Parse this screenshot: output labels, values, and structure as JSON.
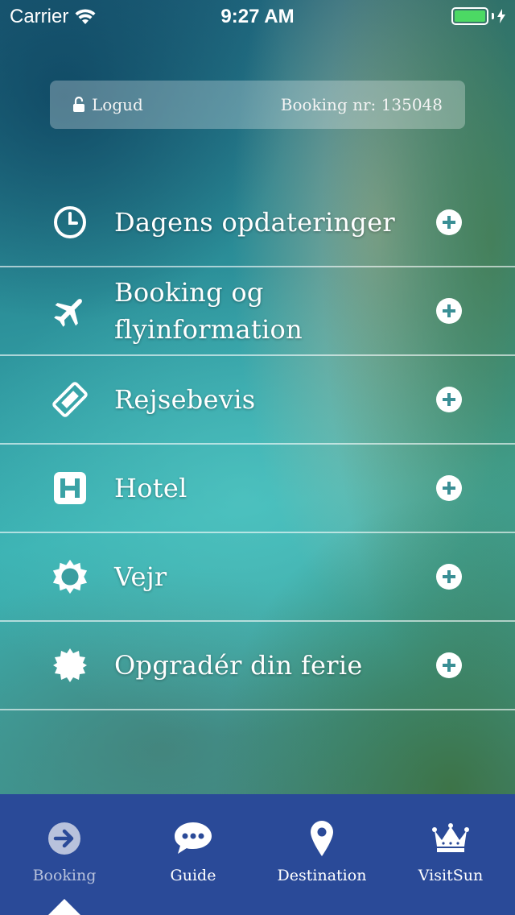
{
  "status_bar": {
    "carrier": "Carrier",
    "time": "9:27 AM",
    "battery_color": "#4cd964"
  },
  "info_bar": {
    "logout_label": "Logud",
    "booking_label": "Booking nr: 135048"
  },
  "menu": {
    "items": [
      {
        "label": "Dagens opdateringer",
        "icon": "clock-icon"
      },
      {
        "label": "Booking og flyinformation",
        "icon": "airplane-icon"
      },
      {
        "label": "Rejsebevis",
        "icon": "ticket-icon"
      },
      {
        "label": "Hotel",
        "icon": "hotel-icon"
      },
      {
        "label": "Vejr",
        "icon": "sun-icon"
      },
      {
        "label": "Opgradér din ferie",
        "icon": "badge-icon"
      }
    ]
  },
  "tab_bar": {
    "background": "#2a4a98",
    "active_tab": "Booking",
    "tabs": [
      {
        "label": "Booking",
        "icon": "arrow-circle-icon"
      },
      {
        "label": "Guide",
        "icon": "chat-bubble-icon"
      },
      {
        "label": "Destination",
        "icon": "map-pin-icon"
      },
      {
        "label": "VisitSun",
        "icon": "crown-icon"
      }
    ]
  }
}
